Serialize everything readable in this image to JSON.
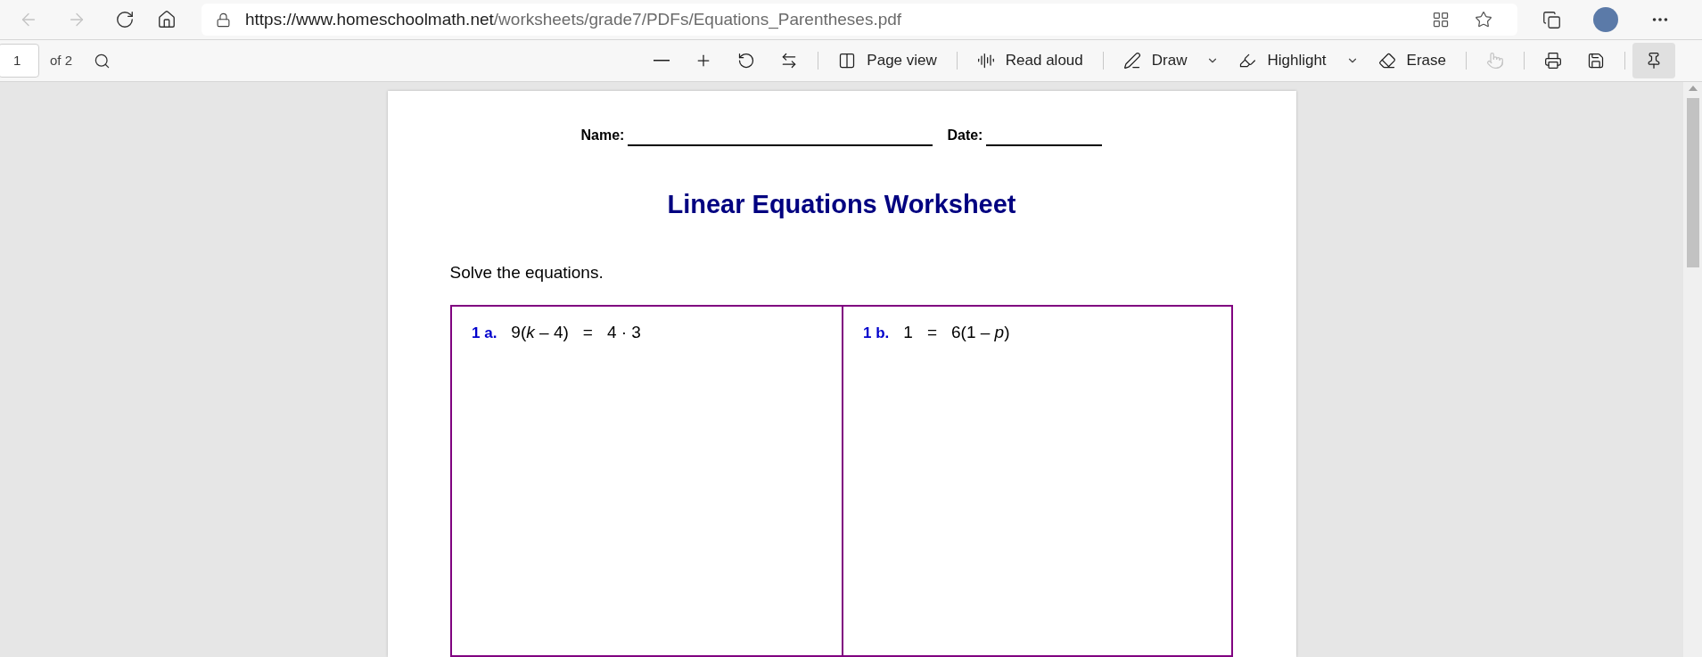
{
  "address_bar": {
    "url_host": "https://www.homeschoolmath.net",
    "url_path": "/worksheets/grade7/PDFs/Equations_Parentheses.pdf"
  },
  "pdf_toolbar": {
    "page_number": "1",
    "page_count": "of 2",
    "buttons": [
      {
        "kind": "zoom-out",
        "disabled": false,
        "pressed": false
      },
      {
        "kind": "zoom-in",
        "disabled": false,
        "pressed": false
      },
      {
        "kind": "rotate",
        "disabled": false,
        "pressed": false
      },
      {
        "kind": "fit",
        "disabled": false,
        "pressed": false
      },
      {
        "kind": "divider"
      },
      {
        "kind": "page-view",
        "label": "Page view",
        "disabled": false,
        "pressed": false
      },
      {
        "kind": "divider"
      },
      {
        "kind": "read-aloud",
        "label": "Read aloud",
        "disabled": false,
        "pressed": false
      },
      {
        "kind": "divider"
      },
      {
        "kind": "draw",
        "label": "Draw",
        "disabled": false,
        "pressed": false
      },
      {
        "kind": "highlight",
        "label": "Highlight",
        "disabled": false,
        "pressed": false
      },
      {
        "kind": "erase",
        "label": "Erase",
        "disabled": false,
        "pressed": false
      },
      {
        "kind": "divider"
      },
      {
        "kind": "touch",
        "disabled": true,
        "pressed": false
      },
      {
        "kind": "divider"
      },
      {
        "kind": "print",
        "disabled": false,
        "pressed": false
      },
      {
        "kind": "save",
        "disabled": false,
        "pressed": false
      },
      {
        "kind": "divider"
      },
      {
        "kind": "pin",
        "disabled": false,
        "pressed": true
      }
    ]
  },
  "worksheet": {
    "name_label": "Name:",
    "date_label": "Date:",
    "title": "Linear Equations Worksheet",
    "instruction": "Solve the equations.",
    "problems": [
      {
        "label": "1 a.",
        "parts": [
          "9(*k* – 4)",
          "=",
          "4 · 3"
        ]
      },
      {
        "label": "1 b.",
        "parts": [
          "1",
          "=",
          "6(1 – *p*)"
        ]
      }
    ]
  }
}
